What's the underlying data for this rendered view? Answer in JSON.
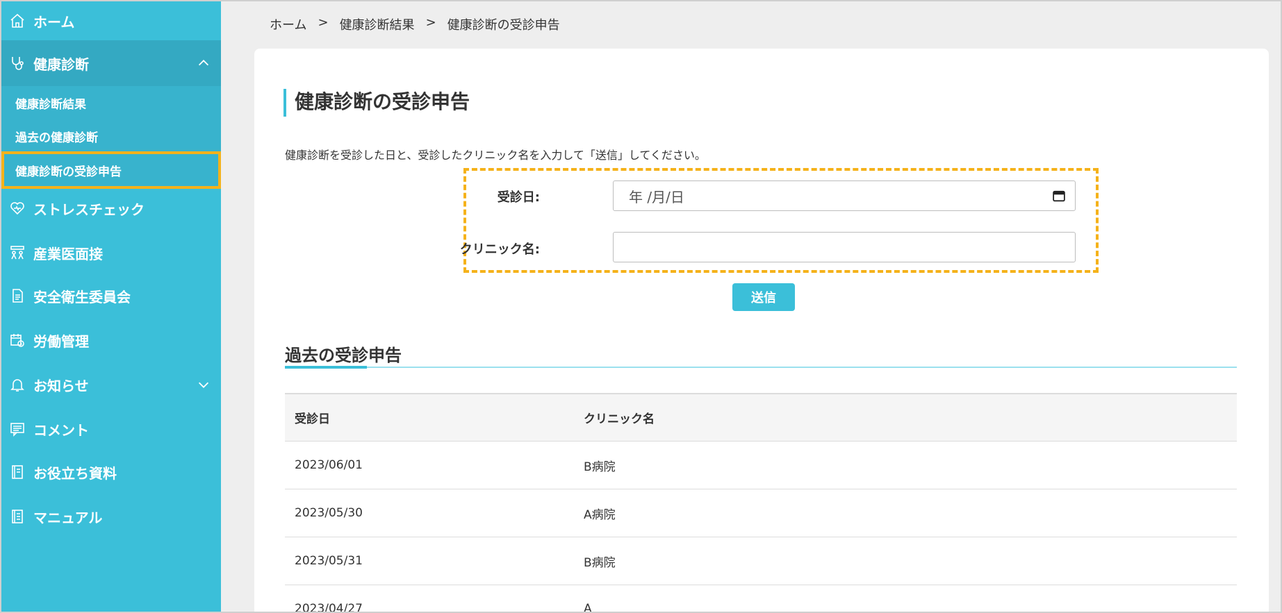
{
  "sidebar": {
    "items": [
      {
        "label": "ホーム",
        "icon": "home-icon"
      },
      {
        "label": "健康診断",
        "icon": "stethoscope-icon"
      },
      {
        "label": "ストレスチェック",
        "icon": "heart-icon"
      },
      {
        "label": "産業医面接",
        "icon": "meeting-icon"
      },
      {
        "label": "安全衛生委員会",
        "icon": "document-icon"
      },
      {
        "label": "労働管理",
        "icon": "calendar-clock-icon"
      },
      {
        "label": "お知らせ",
        "icon": "bell-icon"
      },
      {
        "label": "コメント",
        "icon": "comment-icon"
      },
      {
        "label": "お役立ち資料",
        "icon": "book-icon"
      },
      {
        "label": "マニュアル",
        "icon": "manual-icon"
      }
    ],
    "sub_items": [
      {
        "label": "健康診断結果"
      },
      {
        "label": "過去の健康診断"
      },
      {
        "label": "健康診断の受診申告"
      }
    ]
  },
  "breadcrumb": {
    "items": [
      "ホーム",
      "健康診断結果",
      "健康診断の受診申告"
    ],
    "separator": ">"
  },
  "main": {
    "title": "健康診断の受診申告",
    "description": "健康診断を受診した日と、受診したクリニック名を入力して「送信」してください。",
    "form": {
      "date_label": "受診日:",
      "date_placeholder": "年 /月/日",
      "clinic_label": "クリニック名:",
      "clinic_value": "",
      "submit_label": "送信"
    },
    "history": {
      "title": "過去の受診申告",
      "columns": [
        "受診日",
        "クリニック名"
      ],
      "rows": [
        [
          "2023/06/01",
          "B病院"
        ],
        [
          "2023/05/30",
          "A病院"
        ],
        [
          "2023/05/31",
          "B病院"
        ],
        [
          "2023/04/27",
          "A"
        ]
      ]
    }
  },
  "colors": {
    "accent": "#3bbfd9",
    "highlight": "#f5b21a"
  }
}
